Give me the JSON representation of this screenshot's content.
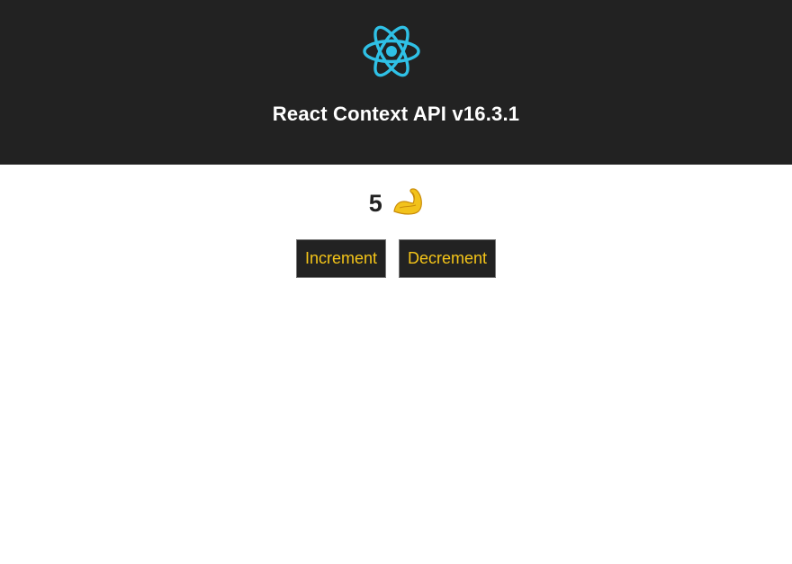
{
  "header": {
    "logo_icon": "react-atom-icon",
    "title": "React Context API v16.3.1",
    "background": "#222222",
    "logo_color": "#2fc1e6"
  },
  "counter": {
    "value": "5",
    "icon": "flexed-biceps-icon"
  },
  "buttons": {
    "increment_label": "Increment",
    "decrement_label": "Decrement",
    "text_color": "#f5c518"
  }
}
